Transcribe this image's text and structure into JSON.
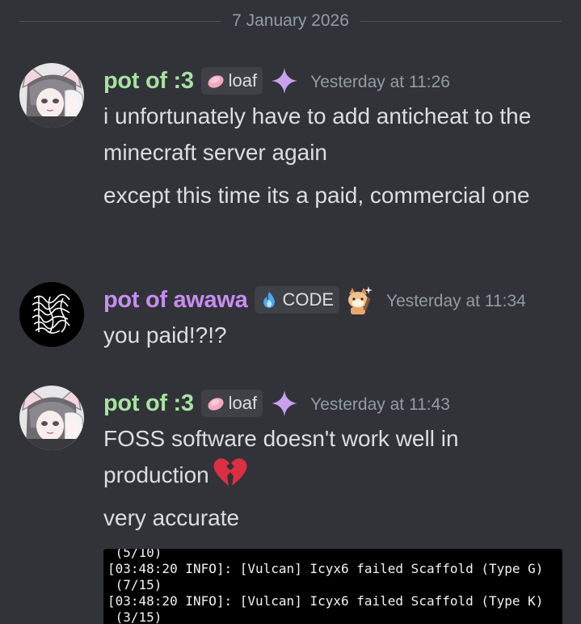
{
  "date_divider": "7 January 2026",
  "messages": [
    {
      "username": "pot of :3",
      "tag": "loaf",
      "timestamp": "Yesterday at 11:26",
      "lines": [
        "i unfortunately have to add anticheat to the minecraft server again",
        "except this time its a paid, commercial one"
      ]
    },
    {
      "username": "pot of awawa",
      "tag": "CODE",
      "timestamp": "Yesterday at 11:34",
      "lines": [
        "you paid!?!?"
      ]
    },
    {
      "username": "pot of :3",
      "tag": "loaf",
      "timestamp": "Yesterday at 11:43",
      "lines": [
        "FOSS software doesn't work well in production",
        "very accurate"
      ],
      "code_lines": [
        " (5/10)",
        "[03:48:20 INFO]: [Vulcan] Icyx6 failed Scaffold (Type G)",
        " (7/15)",
        "[03:48:20 INFO]: [Vulcan] Icyx6 failed Scaffold (Type K)",
        " (3/15)"
      ]
    }
  ],
  "colors": {
    "background": "#313338",
    "username_green": "#a6e3a1",
    "username_purple": "#c78df2",
    "timestamp": "#949ba4",
    "tag_background": "#3f4147",
    "code_background": "#000000"
  },
  "icons": {
    "loaf_tag": "loaf-icon",
    "code_tag": "flame-icon",
    "sparkle": "sparkle-icon",
    "broken_heart": "broken-heart-icon",
    "cat_deco": "cat-decoration-icon"
  }
}
